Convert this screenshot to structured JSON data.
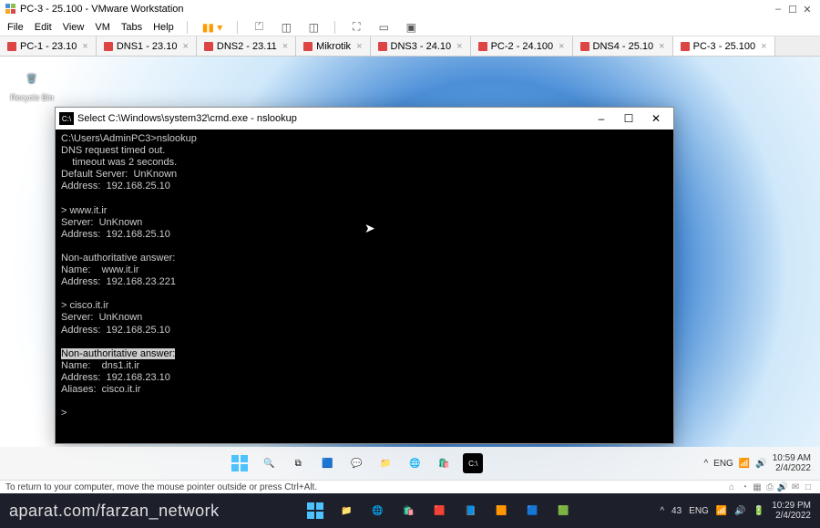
{
  "vmware": {
    "title": "PC-3 - 25.100 - VMware Workstation",
    "menu": [
      "File",
      "Edit",
      "View",
      "VM",
      "Tabs",
      "Help"
    ]
  },
  "tabs": [
    {
      "label": "PC-1 - 23.10"
    },
    {
      "label": "DNS1 - 23.10"
    },
    {
      "label": "DNS2 - 23.11"
    },
    {
      "label": "Mikrotik"
    },
    {
      "label": "DNS3 - 24.10"
    },
    {
      "label": "PC-2 - 24.100"
    },
    {
      "label": "DNS4 - 25.10"
    },
    {
      "label": "PC-3 - 25.100",
      "active": true
    }
  ],
  "desktop": {
    "recycle": "Recycle Bin"
  },
  "cmd": {
    "title": "Select C:\\Windows\\system32\\cmd.exe - nslookup",
    "lines": [
      "C:\\Users\\AdminPC3>nslookup",
      "DNS request timed out.",
      "    timeout was 2 seconds.",
      "Default Server:  UnKnown",
      "Address:  192.168.25.10",
      "",
      "> www.it.ir",
      "Server:  UnKnown",
      "Address:  192.168.25.10",
      "",
      "Non-authoritative answer:",
      "Name:    www.it.ir",
      "Address:  192.168.23.221",
      "",
      "> cisco.it.ir",
      "Server:  UnKnown",
      "Address:  192.168.25.10",
      ""
    ],
    "highlight": "Non-authoritative answer:",
    "lines2": [
      "Name:    dns1.it.ir",
      "Address:  192.168.23.10",
      "Aliases:  cisco.it.ir",
      "",
      ">"
    ]
  },
  "inner_tray": {
    "lang": "ENG",
    "time": "10:59 AM",
    "date": "2/4/2022"
  },
  "hint": "To return to your computer, move the mouse pointer outside or press Ctrl+Alt.",
  "host": {
    "watermark": "aparat.com/farzan_network",
    "lang": "ENG",
    "vol": "43",
    "time": "10:29 PM",
    "date": "2/4/2022"
  }
}
